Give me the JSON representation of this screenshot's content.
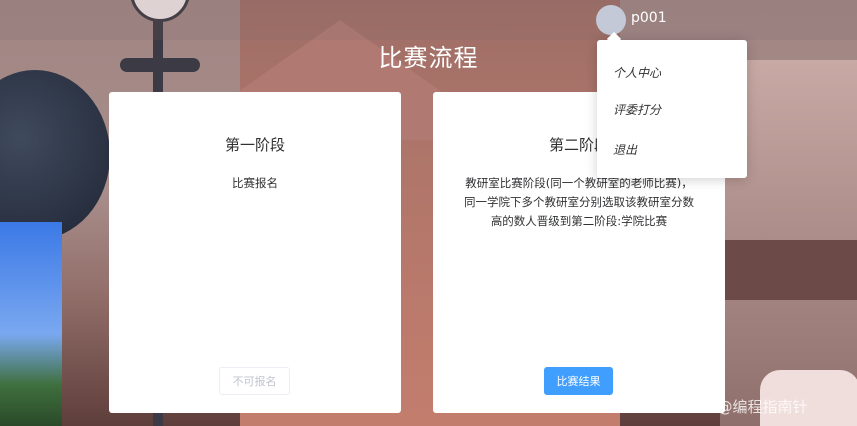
{
  "header": {
    "username": "p001",
    "title": "比赛流程"
  },
  "dropdown": {
    "items": [
      "个人中心",
      "评委打分",
      "退出"
    ]
  },
  "cards": [
    {
      "title": "第一阶段",
      "description": "比赛报名",
      "button": "不可报名"
    },
    {
      "title": "第二阶段",
      "description": "教研室比赛阶段(同一个教研室的老师比赛)，同一学院下多个教研室分别选取该教研室分数高的数人晋级到第二阶段:学院比赛",
      "button": "比赛结果"
    }
  ],
  "watermark": "CSDN @编程指南针"
}
